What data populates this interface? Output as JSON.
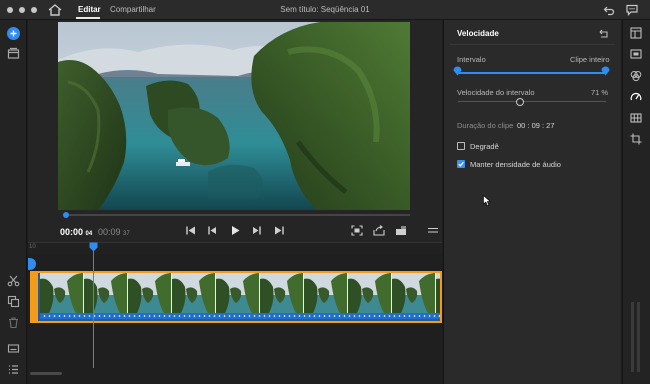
{
  "titlebar": {
    "tabs": [
      {
        "label": "Editar",
        "active": true
      },
      {
        "label": "Compartilhar",
        "active": false
      }
    ],
    "document_title": "Sem título: Seqüência 01",
    "icons": [
      "home-icon",
      "undo-icon",
      "feedback-icon"
    ]
  },
  "player": {
    "current_time": "00:00",
    "current_frames": "04",
    "duration_time": "00:09",
    "duration_frames": "37",
    "progress": 0.01,
    "controls": [
      "go-to-start-icon",
      "step-back-icon",
      "play-icon",
      "step-forward-icon",
      "go-to-end-icon",
      "fit-icon",
      "export-frame-icon",
      "aspect-icon",
      "menu-icon"
    ]
  },
  "timeline": {
    "ruler_label": "10",
    "playhead_time": "00:00:04"
  },
  "speed_panel": {
    "title": "Velocidade",
    "range_label_left": "Intervalo",
    "range_label_right": "Clipe inteiro",
    "speed_label": "Velocidade do intervalo",
    "speed_value": "71 %",
    "speed_level": 0.42,
    "duration_label": "Duração do clipe",
    "duration_value": "00 : 09 : 27",
    "options": [
      {
        "label": "Degradê",
        "checked": false
      },
      {
        "label": "Manter densidade de áudio",
        "checked": true
      }
    ]
  },
  "colors": {
    "accent": "#2f8cf0",
    "clip_border": "#f39b1b",
    "speed_bar": "#1f6fd0",
    "background": "#1d1d1d",
    "panel": "#2a2a2a"
  },
  "left_tools": [
    "add-icon",
    "media-icon",
    "scissors-icon",
    "duplicate-icon",
    "trash-icon",
    "captions-icon",
    "list-icon"
  ],
  "right_tools": [
    "layout-icon",
    "transform-icon",
    "color-icon",
    "speed-icon",
    "grid-icon",
    "crop-icon"
  ]
}
